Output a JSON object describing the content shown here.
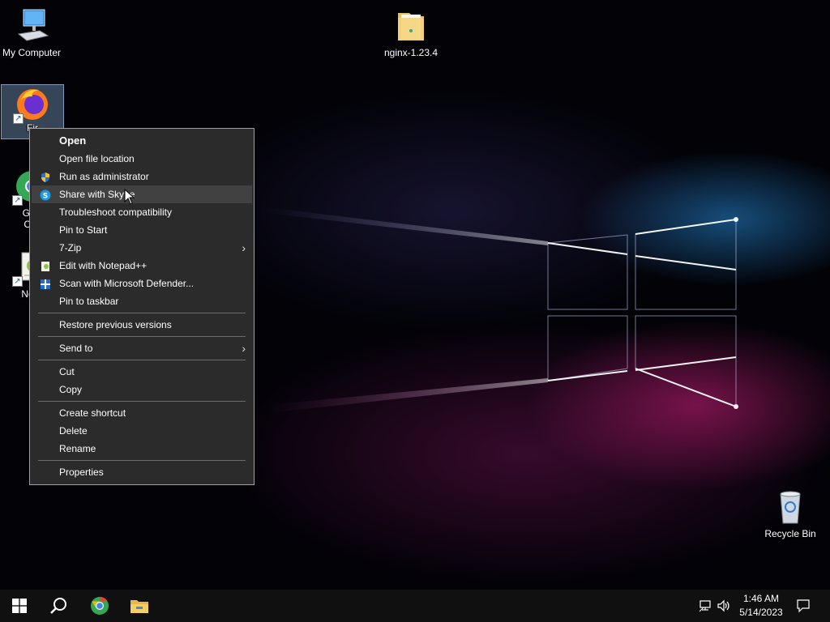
{
  "desktop": {
    "icons": {
      "my_computer": "My Computer",
      "nginx": "nginx-1.23.4",
      "firefox": "Fir",
      "chrome": "Goo Chr",
      "chrome_line1": "Goo",
      "chrome_line2": "Chr",
      "notepad": "Note",
      "recycle_bin": "Recycle Bin"
    }
  },
  "context_menu": {
    "items": [
      {
        "label": "Open",
        "bold": true
      },
      {
        "label": "Open file location"
      },
      {
        "label": "Run as administrator",
        "icon": "uac-shield-icon"
      },
      {
        "label": "Share with Skype",
        "icon": "skype-icon",
        "highlighted": true
      },
      {
        "label": "Troubleshoot compatibility"
      },
      {
        "label": "Pin to Start"
      },
      {
        "label": "7-Zip",
        "submenu": true
      },
      {
        "label": "Edit with Notepad++",
        "icon": "notepadpp-icon"
      },
      {
        "label": "Scan with Microsoft Defender...",
        "icon": "defender-icon"
      },
      {
        "label": "Pin to taskbar"
      },
      {
        "label": "Restore previous versions"
      },
      {
        "label": "Send to",
        "submenu": true
      },
      {
        "label": "Cut"
      },
      {
        "label": "Copy"
      },
      {
        "label": "Create shortcut"
      },
      {
        "label": "Delete"
      },
      {
        "label": "Rename"
      },
      {
        "label": "Properties"
      }
    ]
  },
  "taskbar": {
    "clock_time": "1:46 AM",
    "clock_date": "5/14/2023"
  },
  "colors": {
    "menu_bg": "#2b2b2b",
    "menu_hover": "#414141",
    "taskbar_bg": "#101010",
    "windows_blue": "#00a4ef"
  }
}
